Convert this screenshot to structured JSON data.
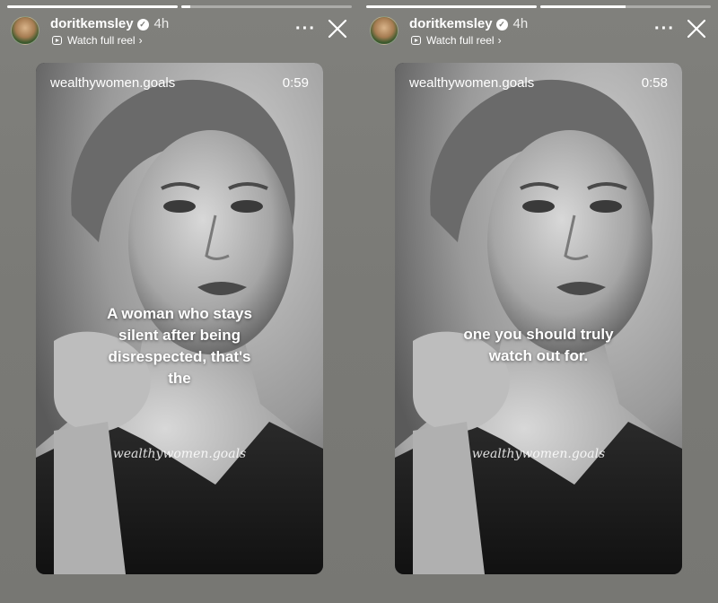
{
  "stories": [
    {
      "progress": [
        1.0,
        0.05
      ],
      "username": "doritkemsley",
      "time": "4h",
      "reel_link": "Watch full reel",
      "handle": "wealthywomen.goals",
      "duration": "0:59",
      "caption_lines": [
        "A woman who stays",
        "silent after being",
        "disrespected, that's",
        "the"
      ],
      "watermark": "wealthywomen.goals"
    },
    {
      "progress": [
        1.0,
        0.5
      ],
      "username": "doritkemsley",
      "time": "4h",
      "reel_link": "Watch full reel",
      "handle": "wealthywomen.goals",
      "duration": "0:58",
      "caption_lines": [
        "one you should truly",
        "watch out for."
      ],
      "watermark": "wealthywomen.goals"
    }
  ],
  "icons": {
    "verified": "verified-badge-icon",
    "reel": "reel-icon",
    "chevron": "chevron-right-icon",
    "more": "more-icon",
    "close": "close-icon"
  }
}
